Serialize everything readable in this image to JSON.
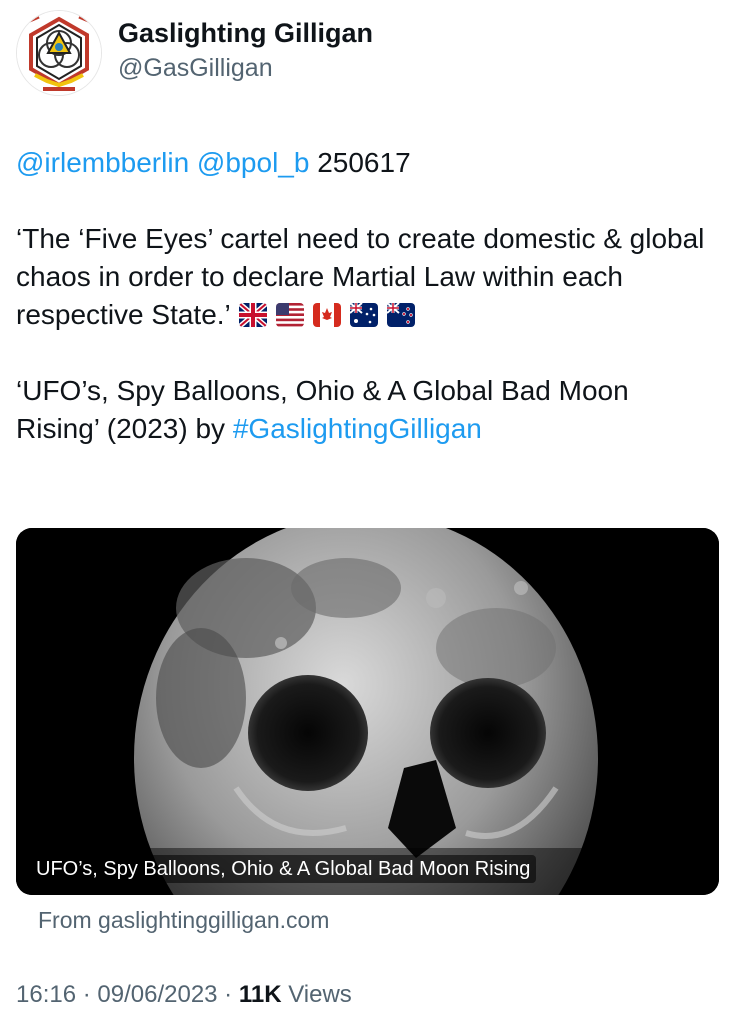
{
  "author": {
    "display_name": "Gaslighting Gilligan",
    "handle": "@GasGilligan",
    "avatar_icon": "geometric-logo-icon"
  },
  "tweet": {
    "mentions": [
      "@irlembberlin",
      "@bpol_b"
    ],
    "code": "250617",
    "quote": "‘The ‘Five Eyes’ cartel need to create domestic & global chaos in order to declare Martial Law within each respective State.’",
    "flags": [
      "uk-flag",
      "us-flag",
      "canada-flag",
      "australia-flag",
      "new-zealand-flag"
    ],
    "title_line": "‘UFO’s, Spy Balloons, Ohio & A Global Bad Moon Rising’ (2023) by",
    "hashtag": "#GaslightingGilligan"
  },
  "card": {
    "caption": "UFO’s, Spy Balloons, Ohio & A Global Bad Moon Rising",
    "source": "From gaslightinggilligan.com",
    "image_description": "moon-skull-image"
  },
  "meta": {
    "time": "16:16",
    "separator": " · ",
    "date": "09/06/2023",
    "views_count": "11K",
    "views_label": "Views"
  },
  "colors": {
    "link": "#1d9bf0",
    "secondary_text": "#536471",
    "primary_text": "#0f1419"
  }
}
